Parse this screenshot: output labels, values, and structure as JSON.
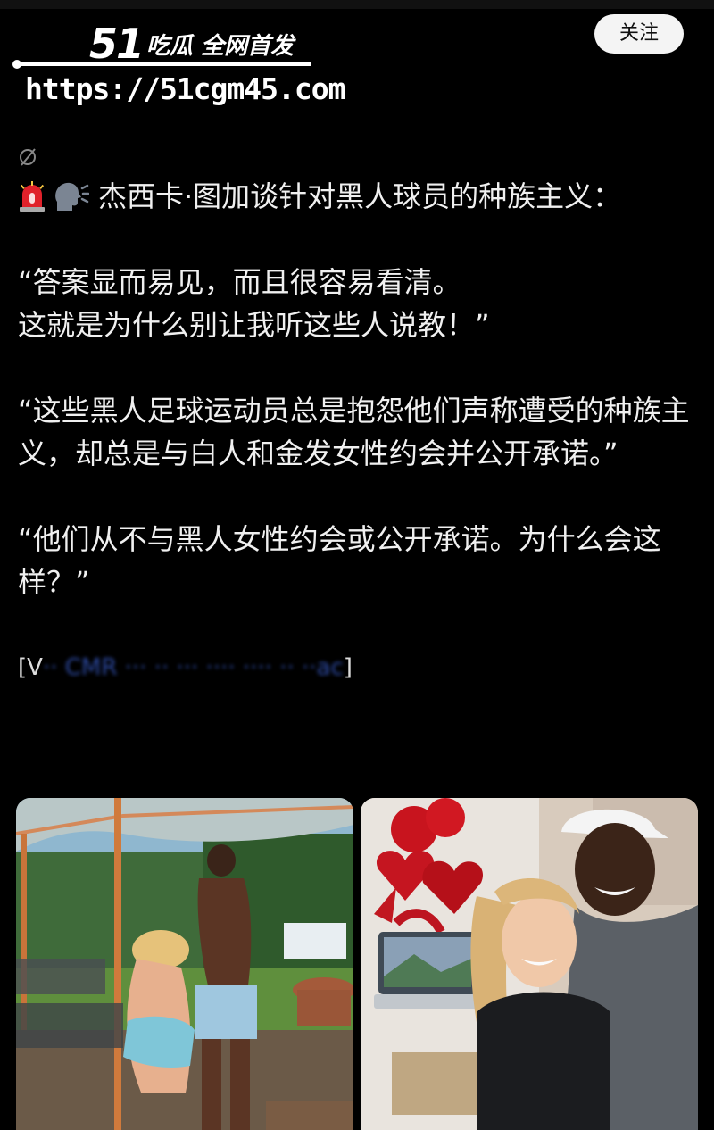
{
  "watermark": {
    "logo_number": "51",
    "logo_text": "吃瓜 全网首发",
    "url": "https://51cgm45.com"
  },
  "header": {
    "follow_label": "关注"
  },
  "post": {
    "icons": [
      "slash-circle-icon",
      "siren-icon",
      "speaking-head-icon"
    ],
    "headline": "杰西卡·图加谈针对黑人球员的种族主义：",
    "quote1_line1": "“答案显而易见，而且很容易看清。",
    "quote1_line2": "这就是为什么别让我听这些人说教！”",
    "quote2": "“这些黑人足球运动员总是抱怨他们声称遭受的种族主义，却总是与白人和金发女性约会并公开承诺。”",
    "quote3": "“他们从不与黑人女性约会或公开承诺。为什么会这样？”",
    "blurred_open": "[V",
    "blurred_text": "·· CMR ··· ·· ··· ···· ···· ·· ··ac",
    "blurred_close": "]"
  },
  "colors": {
    "background": "#000000",
    "text": "#f0f0f0",
    "button_bg": "#f4f4f4",
    "link_blur": "#3a5fcf"
  }
}
